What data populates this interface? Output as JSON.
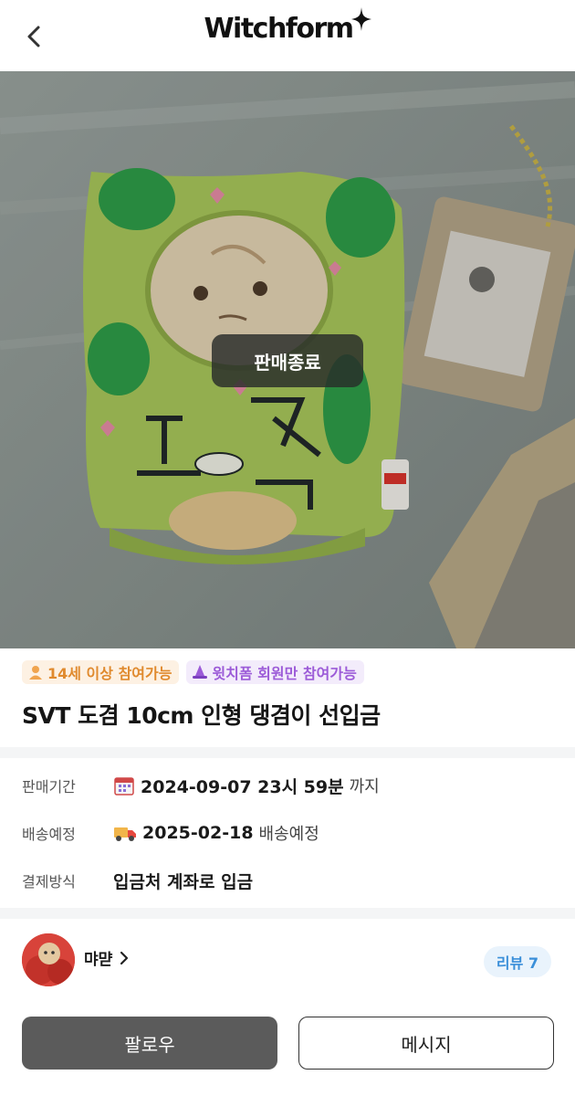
{
  "header": {
    "logo_text": "Witchform"
  },
  "product": {
    "status_overlay": "판매종료",
    "tags": [
      {
        "label": "14세 이상 참여가능",
        "color": "#e08a2e"
      },
      {
        "label": "윗치폼 회원만 참여가능",
        "color": "#9c5bd8"
      }
    ],
    "title": "SVT 도겸 10cm 인형 댕겸이 선입금"
  },
  "info": {
    "rows": [
      {
        "label": "판매기간",
        "icon": "calendar-icon",
        "value": "2024-09-07 23시 59분",
        "suffix": "까지"
      },
      {
        "label": "배송예정",
        "icon": "truck-icon",
        "value": "2025-02-18",
        "suffix": "배송예정"
      },
      {
        "label": "결제방식",
        "icon": "",
        "value": "입금처 계좌로 입금",
        "suffix": ""
      }
    ]
  },
  "seller": {
    "name": "먀먇",
    "review_label": "리뷰 7"
  },
  "actions": {
    "follow_label": "팔로우",
    "message_label": "메시지"
  },
  "colors": {
    "follow_button": "#5b5b5b",
    "review_badge_bg": "#e9f3fc",
    "review_badge_text": "#3a8fd9"
  }
}
